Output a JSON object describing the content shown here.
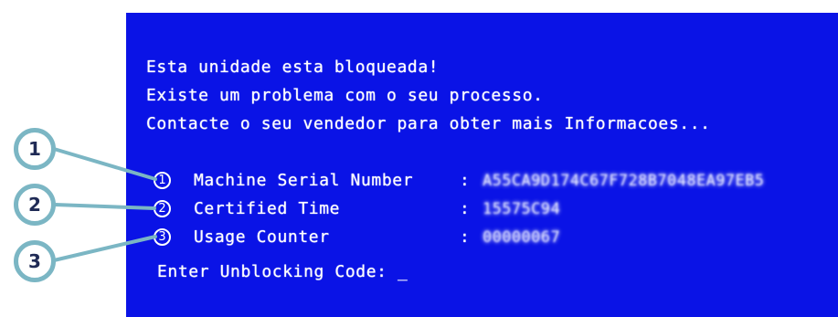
{
  "screen": {
    "background_color": "#0a13e6",
    "message_lines": [
      "Esta unidade esta bloqueada!",
      "Existe um problema com o seu processo.",
      "Contacte o seu vendedor para obter mais Informacoes..."
    ],
    "fields": [
      {
        "number": "1",
        "label": "Machine Serial Number",
        "separator": ":",
        "value": "A55CA9D174C67F728B7048EA97EB5"
      },
      {
        "number": "2",
        "label": "Certified Time",
        "separator": ":",
        "value": "15575C94"
      },
      {
        "number": "3",
        "label": "Usage Counter",
        "separator": ":",
        "value": "00000067"
      }
    ],
    "unblock_prompt": "Enter Unblocking Code: _"
  },
  "callouts": [
    "1",
    "2",
    "3"
  ],
  "callout_color": "#7bb6c4"
}
